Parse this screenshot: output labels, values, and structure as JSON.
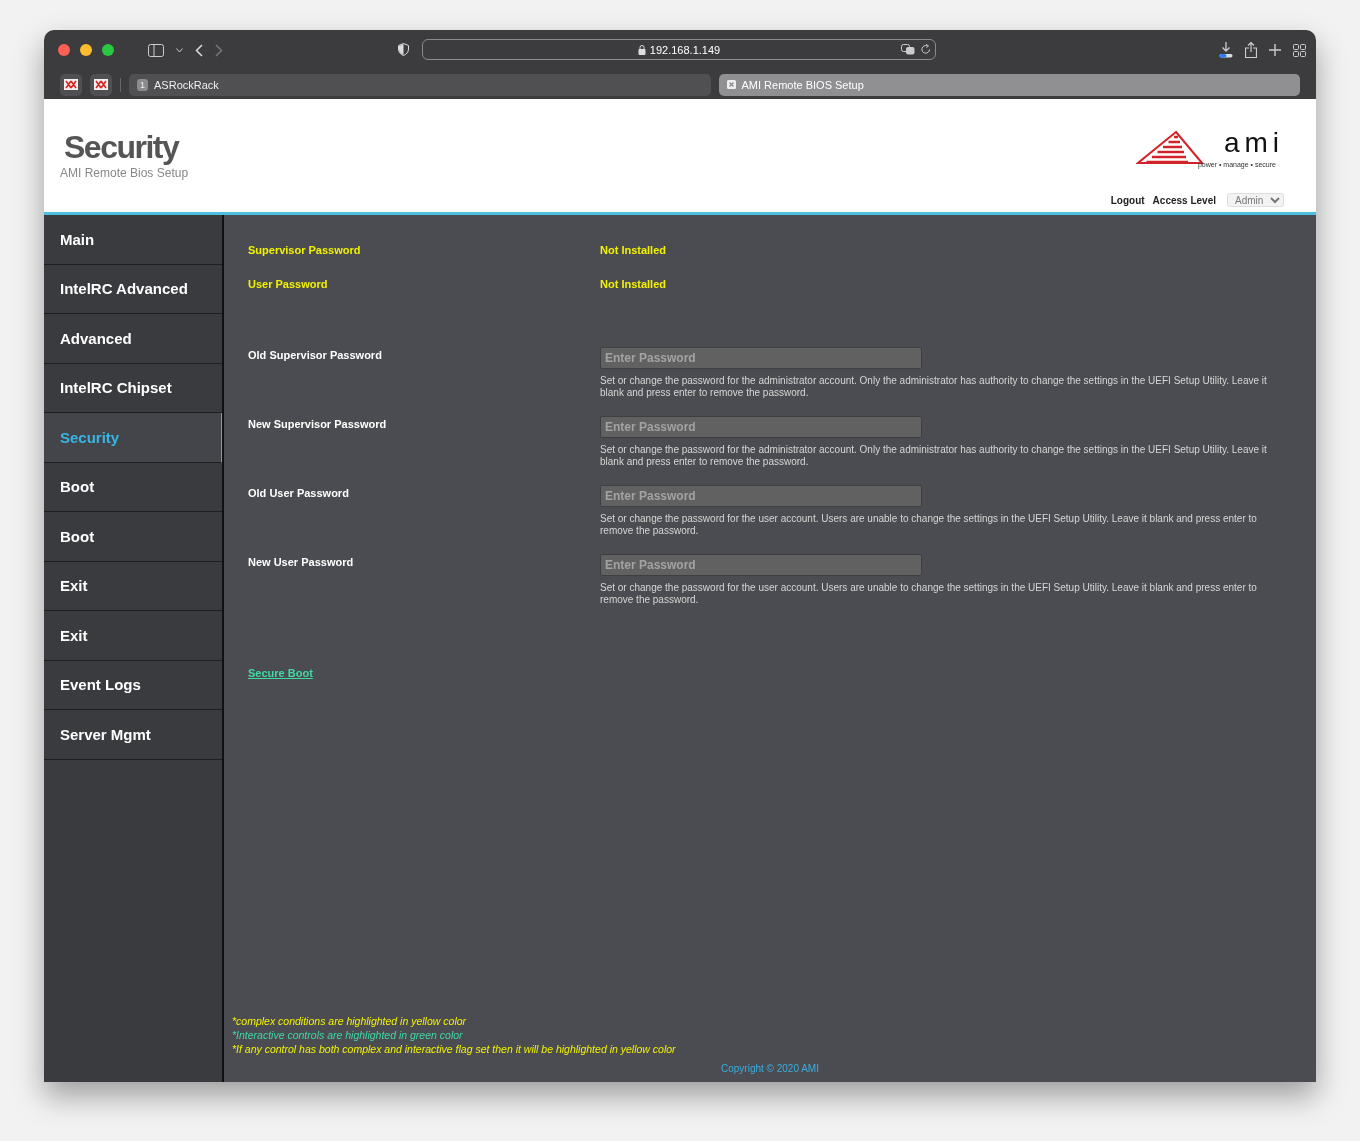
{
  "browser": {
    "url": "192.168.1.149",
    "tabs": [
      {
        "kind": "numbered",
        "badge": "1",
        "label": "ASRockRack",
        "selected": false
      },
      {
        "kind": "site",
        "label": "AMI Remote BIOS Setup",
        "selected": true
      }
    ]
  },
  "header": {
    "title": "Security",
    "subtitle": "AMI Remote Bios Setup",
    "logo_text": "ami",
    "logo_tagline": "power • manage • secure",
    "logout": "Logout",
    "access_level_label": "Access Level",
    "access_level_value": "Admin"
  },
  "sidebar": {
    "items": [
      {
        "label": "Main",
        "selected": false
      },
      {
        "label": "IntelRC Advanced",
        "selected": false
      },
      {
        "label": "Advanced",
        "selected": false
      },
      {
        "label": "IntelRC Chipset",
        "selected": false
      },
      {
        "label": "Security",
        "selected": true
      },
      {
        "label": "Boot",
        "selected": false
      },
      {
        "label": "Boot",
        "selected": false
      },
      {
        "label": "Exit",
        "selected": false
      },
      {
        "label": "Exit",
        "selected": false
      },
      {
        "label": "Event Logs",
        "selected": false
      },
      {
        "label": "Server Mgmt",
        "selected": false
      }
    ]
  },
  "status": [
    {
      "label": "Supervisor Password",
      "value": "Not Installed"
    },
    {
      "label": "User Password",
      "value": "Not Installed"
    }
  ],
  "password_fields": [
    {
      "label": "Old Supervisor Password",
      "placeholder": "Enter Password",
      "help": "Set or change the password for the administrator account. Only the administrator has authority to change the settings in the UEFI Setup Utility. Leave it blank and press enter to remove the password."
    },
    {
      "label": "New Supervisor Password",
      "placeholder": "Enter Password",
      "help": "Set or change the password for the administrator account. Only the administrator has authority to change the settings in the UEFI Setup Utility. Leave it blank and press enter to remove the password."
    },
    {
      "label": "Old User Password",
      "placeholder": "Enter Password",
      "help": "Set or change the password for the user account. Users are unable to change the settings in the UEFI Setup Utility. Leave it blank and press enter to remove the password."
    },
    {
      "label": "New User Password",
      "placeholder": "Enter Password",
      "help": "Set or change the password for the user account. Users are unable to change the settings in the UEFI Setup Utility. Leave it blank and press enter to remove the password."
    }
  ],
  "link": "Secure Boot",
  "notes": [
    {
      "text": "*complex conditions are highlighted in yellow color",
      "color": "#f2f200"
    },
    {
      "text": "*Interactive controls are highlighted in green color",
      "color": "#3fd9a4"
    },
    {
      "text": "*If any control has both complex and interactive flag set then it will be highlighted in yellow color",
      "color": "#f2f200"
    }
  ],
  "copyright": "Copyright © 2020 AMI"
}
